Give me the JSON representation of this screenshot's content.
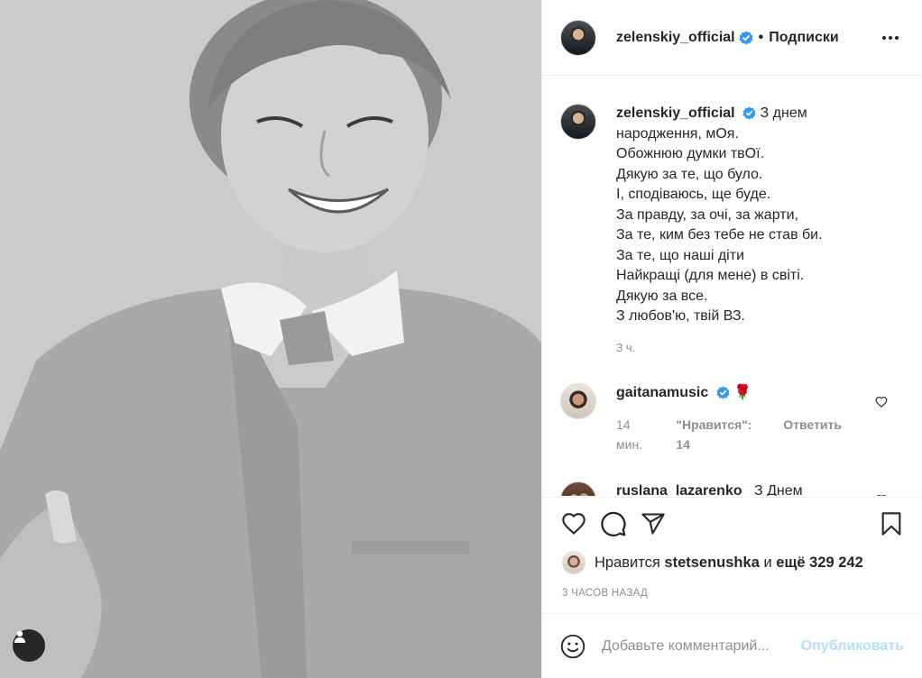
{
  "post": {
    "author": "zelenskiy_official",
    "header_separator": "•",
    "follow_label": "Подписки",
    "caption_lines": [
      "З днем",
      "народження, мОя.",
      "Обожнюю думки твОї.",
      "Дякую за те, що було.",
      "І, сподіваюсь, ще буде.",
      "За правду, за очі, за жарти,",
      "За те, ким без тебе не став би.",
      "За те, що наші діти",
      "Найкращі (для мене) в світі.",
      "Дякую за все.",
      "З любов'ю, твій ВЗ."
    ],
    "caption_time": "3 ч."
  },
  "comments": [
    {
      "user": "gaitanamusic",
      "text": "🌹",
      "time": "14 мин.",
      "likes": "\"Нравится\": 14",
      "reply": "Ответить"
    },
    {
      "user": "ruslana_lazarenko_",
      "text": "З Днем народження😍❤️❤️❤️"
    }
  ],
  "likes": {
    "prefix": "Нравится",
    "user": "stetsenushka",
    "middle": "и",
    "count": "ещё 329 242"
  },
  "timestamp": "3 ЧАСОВ НАЗАД",
  "add_comment": {
    "placeholder": "Добавьте комментарий...",
    "publish_label": "Опубликовать"
  },
  "colors": {
    "accent": "#0095f6",
    "publish_disabled": "#b2dffc",
    "verified": "#3897f0",
    "muted": "#8e8e8e"
  }
}
